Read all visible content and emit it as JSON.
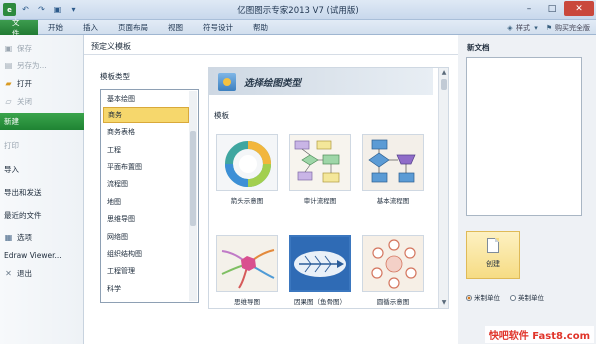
{
  "window": {
    "title": "亿图图示专家2013 V7 (试用版)",
    "controls": {
      "minimize": "–",
      "maximize": "□",
      "close": "✕"
    }
  },
  "ribbon": {
    "file_tab": "文件",
    "tabs": [
      "开始",
      "插入",
      "页面布局",
      "视图",
      "符号设计",
      "帮助"
    ],
    "right": {
      "style_label": "样式",
      "buy_label": "购买完全版"
    }
  },
  "backstage_nav": [
    {
      "label": "保存",
      "icon": "save-icon",
      "enabled": false
    },
    {
      "label": "另存为...",
      "icon": "save-as-icon",
      "enabled": false
    },
    {
      "label": "打开",
      "icon": "open-folder-icon",
      "enabled": true
    },
    {
      "label": "关闭",
      "icon": "close-doc-icon",
      "enabled": false
    },
    {
      "label": "新建",
      "icon": "",
      "enabled": true,
      "active": true
    },
    {
      "label": "打印",
      "icon": "",
      "enabled": false
    },
    {
      "label": "导入",
      "icon": "",
      "enabled": true
    },
    {
      "label": "导出和发送",
      "icon": "",
      "enabled": true
    },
    {
      "label": "最近的文件",
      "icon": "",
      "enabled": true
    },
    {
      "label": "选项",
      "icon": "options-icon",
      "enabled": true
    },
    {
      "label": "Edraw Viewer...",
      "icon": "viewer-icon",
      "enabled": true
    },
    {
      "label": "退出",
      "icon": "exit-icon",
      "enabled": true
    }
  ],
  "main": {
    "title": "预定义模板",
    "category_title": "模板类型",
    "categories": [
      "基本绘图",
      "商务",
      "商务表格",
      "工程",
      "平面布置图",
      "流程图",
      "地图",
      "思维导图",
      "网络图",
      "组织结构图",
      "工程管理",
      "科学"
    ],
    "selected_category": "商务",
    "banner_text": "选择绘图类型",
    "templates_label": "模板",
    "templates": [
      "箭头示意图",
      "审计流程图",
      "基本流程图",
      "思维导图",
      "因果图（鱼骨图）",
      "圆循示意图"
    ]
  },
  "new_doc": {
    "title": "新文档",
    "create_label": "创建",
    "units": [
      {
        "label": "米制单位",
        "selected": true
      },
      {
        "label": "英制单位",
        "selected": false
      }
    ]
  },
  "watermark": "快吧软件 Fast8.com",
  "colors": {
    "accent_green": "#1f8333",
    "selection_yellow": "#f6d76c",
    "watermark_red": "#e0342a"
  }
}
